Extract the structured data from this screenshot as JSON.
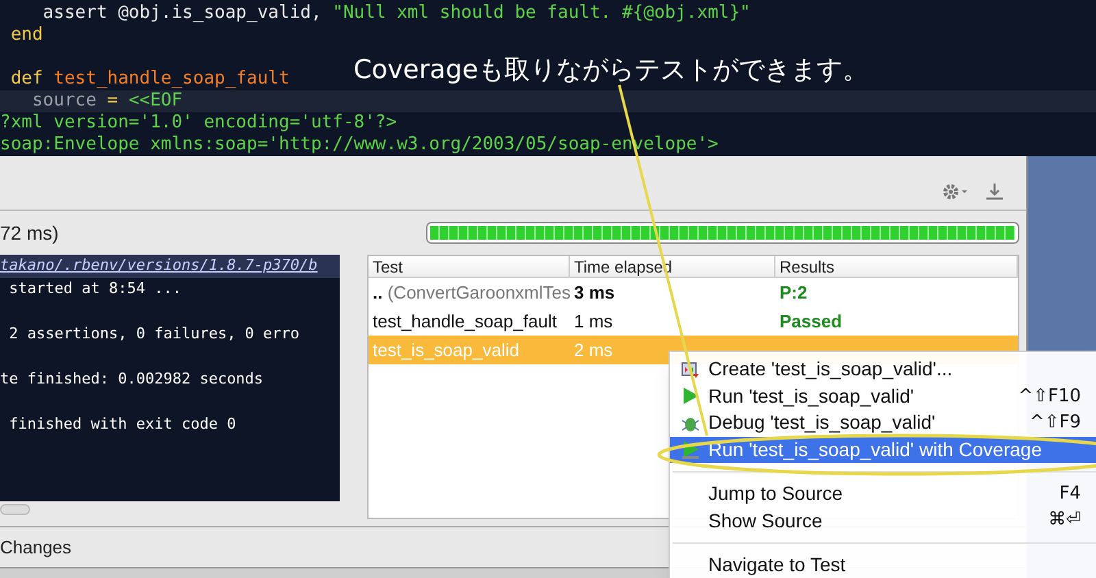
{
  "editor": {
    "blocks": [
      [
        {
          "parts": [
            {
              "t": "    assert @obj.is_soap_valid, ",
              "kind": "plain"
            },
            {
              "t": "\"Null xml should be fault. #{@obj.xml}\"",
              "kind": "string"
            }
          ],
          "current": false
        },
        {
          "parts": [
            {
              "t": " end",
              "kind": "keyword"
            }
          ],
          "current": false
        }
      ],
      [
        {
          "parts": [
            {
              "t": " def ",
              "kind": "keyword"
            },
            {
              "t": "test_handle_soap_fault",
              "kind": "name"
            }
          ],
          "current": false
        },
        {
          "parts": [
            {
              "t": "   source ",
              "kind": "dim"
            },
            {
              "t": "= ",
              "kind": "keyword"
            },
            {
              "t": "<<EOF",
              "kind": "string"
            }
          ],
          "current": true
        },
        {
          "parts": [
            {
              "t": "?xml version='1.0' encoding='utf-8'?>",
              "kind": "string"
            }
          ],
          "current": false
        },
        {
          "parts": [
            {
              "t": "soap:Envelope xmlns:soap='http://www.w3.org/2003/05/soap-envelope'>",
              "kind": "string"
            }
          ],
          "current": false
        }
      ]
    ]
  },
  "annotation": {
    "text": "Coverageも取りながらテストができます。"
  },
  "run_panel": {
    "elapsed": "72 ms)",
    "progress": {
      "level": 1
    },
    "console": {
      "command": "takano/.rbenv/versions/1.8.7-p370/b",
      "blocks": [
        [
          " started at 8:54 ..."
        ],
        [
          " 2 assertions, 0 failures, 0 erro"
        ],
        [
          "te finished: 0.002982 seconds"
        ],
        [
          " finished with exit code 0"
        ]
      ]
    },
    "table": {
      "columns": [
        "Test",
        "Time elapsed",
        "Results"
      ],
      "rows": [
        {
          "test_prefix": "..",
          "test": " (ConvertGaroonxmlTes",
          "time": "3 ms",
          "result": "P:2",
          "bold": true,
          "selected": false
        },
        {
          "test": "test_handle_soap_fault",
          "time": "1 ms",
          "result": "Passed",
          "bold": false,
          "selected": false
        },
        {
          "test": "test_is_soap_valid",
          "time": "2 ms",
          "bold": false,
          "selected": true
        }
      ]
    }
  },
  "bottom_tab": "Changes",
  "context_menu": {
    "items": [
      {
        "kind": "create",
        "label": "Create 'test_is_soap_valid'...",
        "selected": false
      },
      {
        "kind": "run",
        "label": "Run 'test_is_soap_valid'",
        "shortcut": "^⇧F10",
        "selected": false
      },
      {
        "kind": "debug",
        "label": "Debug 'test_is_soap_valid'",
        "shortcut": "^⇧F9",
        "selected": false
      },
      {
        "kind": "coverage",
        "label": "Run 'test_is_soap_valid' with Coverage",
        "selected": true
      },
      {
        "kind": "separator"
      },
      {
        "kind": "plain",
        "label": "Jump to Source",
        "shortcut": "F4",
        "selected": false
      },
      {
        "kind": "plain",
        "label": "Show Source",
        "shortcut": "⌘⏎",
        "selected": false
      },
      {
        "kind": "separator"
      },
      {
        "kind": "plain",
        "label": "Navigate to Test",
        "selected": false
      }
    ]
  }
}
